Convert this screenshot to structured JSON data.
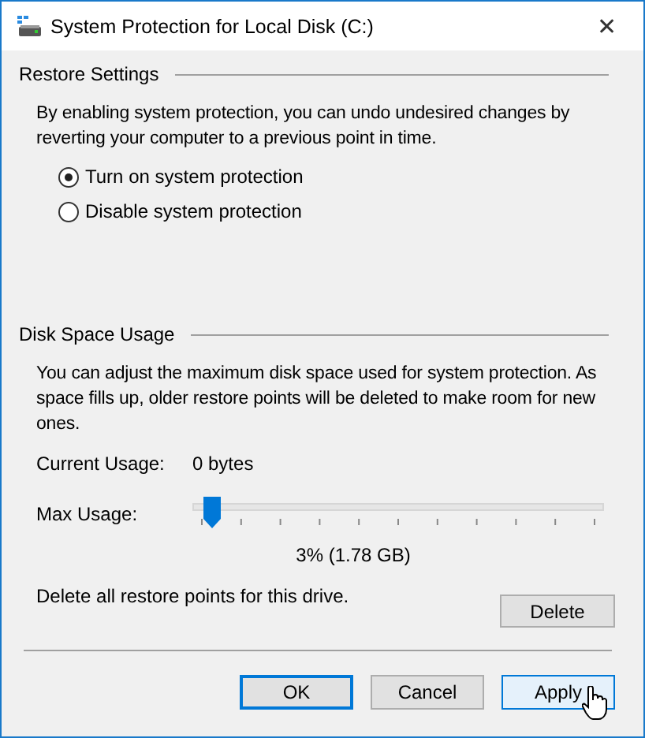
{
  "window": {
    "title": "System Protection for Local Disk (C:)",
    "close": "✕"
  },
  "restore_settings": {
    "heading": "Restore Settings",
    "description": "By enabling system protection, you can undo undesired changes by reverting your computer to a previous point in time.",
    "options": [
      {
        "label": "Turn on system protection",
        "selected": true
      },
      {
        "label": "Disable system protection",
        "selected": false
      }
    ]
  },
  "disk_space_usage": {
    "heading": "Disk Space Usage",
    "description": "You can adjust the maximum disk space used for system protection. As space fills up, older restore points will be deleted to make room for new ones.",
    "current_usage_label": "Current Usage:",
    "current_usage_value": "0 bytes",
    "max_usage_label": "Max Usage:",
    "max_usage_slider": {
      "level": 0.03
    },
    "max_usage_reading": "3% (1.78 GB)",
    "delete_text": "Delete all restore points for this drive.",
    "delete_button": "Delete"
  },
  "buttons": [
    {
      "label": "OK",
      "default": true,
      "hovered": false
    },
    {
      "label": "Cancel",
      "default": false,
      "hovered": false
    },
    {
      "label": "Apply",
      "default": false,
      "hovered": true
    }
  ]
}
